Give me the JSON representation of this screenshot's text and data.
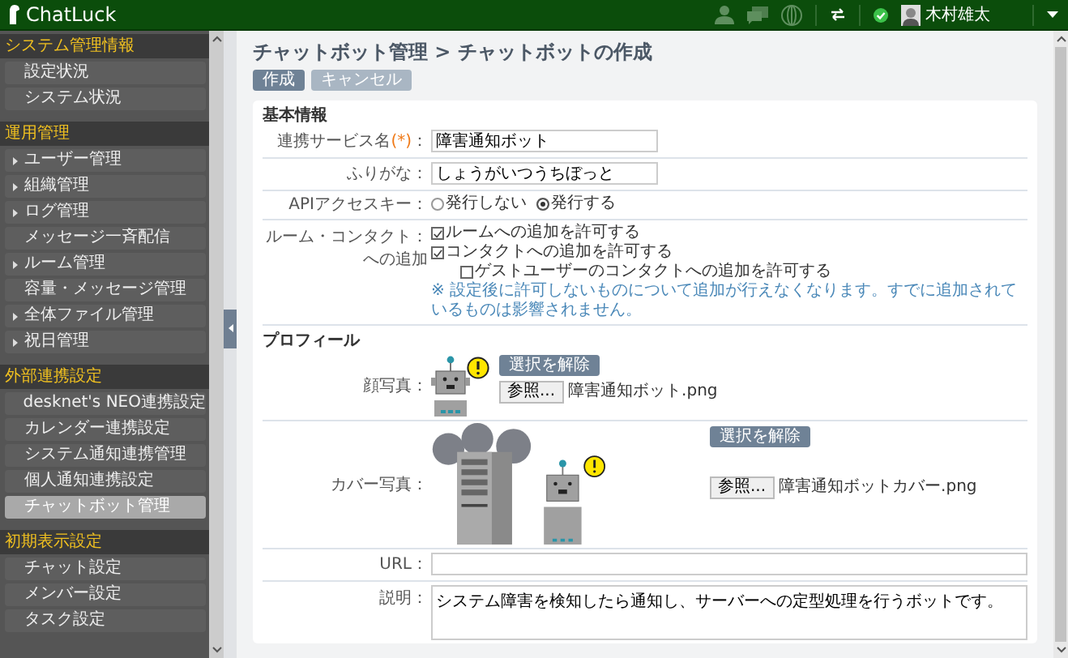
{
  "app": {
    "name": "ChatLuck"
  },
  "header": {
    "user_name": "木村雄太"
  },
  "sidebar": {
    "sections": [
      {
        "title": "システム管理情報",
        "items": [
          {
            "label": "設定状況",
            "expandable": false,
            "selected": false
          },
          {
            "label": "システム状況",
            "expandable": false,
            "selected": false
          }
        ]
      },
      {
        "title": "運用管理",
        "items": [
          {
            "label": "ユーザー管理",
            "expandable": true,
            "selected": false
          },
          {
            "label": "組織管理",
            "expandable": true,
            "selected": false
          },
          {
            "label": "ログ管理",
            "expandable": true,
            "selected": false
          },
          {
            "label": "メッセージ一斉配信",
            "expandable": false,
            "selected": false
          },
          {
            "label": "ルーム管理",
            "expandable": true,
            "selected": false
          },
          {
            "label": "容量・メッセージ管理",
            "expandable": false,
            "selected": false
          },
          {
            "label": "全体ファイル管理",
            "expandable": true,
            "selected": false
          },
          {
            "label": "祝日管理",
            "expandable": true,
            "selected": false
          }
        ]
      },
      {
        "title": "外部連携設定",
        "items": [
          {
            "label": "desknet's NEO連携設定",
            "expandable": false,
            "selected": false
          },
          {
            "label": "カレンダー連携設定",
            "expandable": false,
            "selected": false
          },
          {
            "label": "システム通知連携管理",
            "expandable": false,
            "selected": false
          },
          {
            "label": "個人通知連携設定",
            "expandable": false,
            "selected": false
          },
          {
            "label": "チャットボット管理",
            "expandable": false,
            "selected": true
          }
        ]
      },
      {
        "title": "初期表示設定",
        "items": [
          {
            "label": "チャット設定",
            "expandable": false,
            "selected": false
          },
          {
            "label": "メンバー設定",
            "expandable": false,
            "selected": false
          },
          {
            "label": "タスク設定",
            "expandable": false,
            "selected": false
          }
        ]
      }
    ]
  },
  "page": {
    "breadcrumb": "チャットボット管理 > チャットボットの作成",
    "buttons": [
      {
        "label": "作成",
        "disabled": false
      },
      {
        "label": "キャンセル",
        "disabled": true
      }
    ]
  },
  "basic": {
    "title": "基本情報",
    "service_name": {
      "label": "連携サービス名",
      "required_mark": "(*)",
      "colon": "：",
      "value": "障害通知ボット"
    },
    "furigana": {
      "label": "ふりがな：",
      "value": "しょうがいつうちぼっと"
    },
    "api_key": {
      "label": "APIアクセスキー：",
      "options": [
        {
          "label": "発行しない",
          "selected": false
        },
        {
          "label": "発行する",
          "selected": true
        }
      ]
    },
    "room_contact": {
      "label_lines": [
        "ルーム・コンタクト：",
        "への追加"
      ],
      "options": [
        {
          "label": "ルームへの追加を許可する",
          "checked": true,
          "kind": "main"
        },
        {
          "label": "コンタクトへの追加を許可する",
          "checked": true,
          "kind": "main"
        },
        {
          "label": "ゲストユーザーのコンタクトへの追加を許可する",
          "checked": false,
          "kind": "sub"
        }
      ],
      "note": "※ 設定後に許可しないものについて追加が行えなくなります。すでに追加されているものは影響されません。"
    }
  },
  "profile": {
    "title": "プロフィール",
    "face_photo": {
      "label": "顔写真：",
      "clear_button": "選択を解除",
      "browse_button": "参照...",
      "file_name": "障害通知ボット.png"
    },
    "cover_photo": {
      "label": "カバー写真：",
      "clear_button": "選択を解除",
      "browse_button": "参照...",
      "file_name": "障害通知ボットカバー.png"
    },
    "url": {
      "label": "URL："
    },
    "description": {
      "label": "説明：",
      "value": "システム障害を検知したら通知し、サーバーへの定型処理を行うボットです。"
    }
  }
}
